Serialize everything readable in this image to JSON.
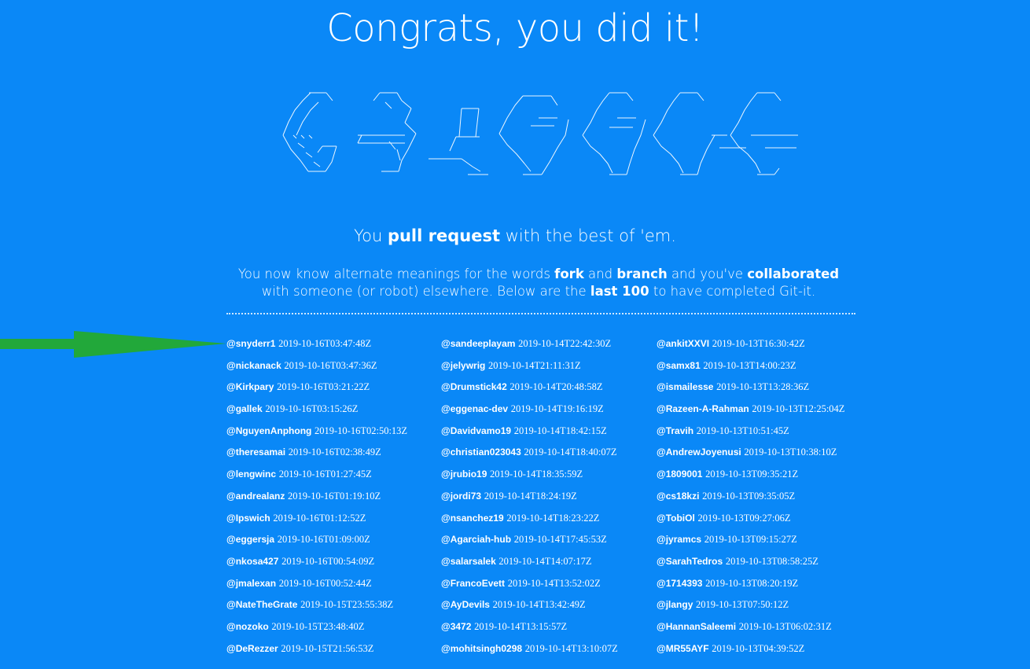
{
  "title": "Congrats, you did it!",
  "tagline": {
    "pre": "You ",
    "bold": "pull request",
    "post": " with the best of 'em."
  },
  "description": {
    "p1": "You now know alternate meanings for the words ",
    "b1": "fork",
    "p2": " and ",
    "b2": "branch",
    "p3": " and you've ",
    "b3": "collaborated",
    "p4": " with someone (or robot) elsewhere. Below are the ",
    "b4": "last 100",
    "p5": " to have completed Git-it."
  },
  "arrow_color": "#22a83a",
  "background_color": "#0a88f7",
  "columns": [
    [
      {
        "user": "@snyderr1",
        "date": "2019-10-16T03:47:48Z"
      },
      {
        "user": "@nickanack",
        "date": "2019-10-16T03:47:36Z"
      },
      {
        "user": "@Kirkpary",
        "date": "2019-10-16T03:21:22Z"
      },
      {
        "user": "@gallek",
        "date": "2019-10-16T03:15:26Z"
      },
      {
        "user": "@NguyenAnphong",
        "date": "2019-10-16T02:50:13Z"
      },
      {
        "user": "@theresamai",
        "date": "2019-10-16T02:38:49Z"
      },
      {
        "user": "@lengwinc",
        "date": "2019-10-16T01:27:45Z"
      },
      {
        "user": "@andrealanz",
        "date": "2019-10-16T01:19:10Z"
      },
      {
        "user": "@Ipswich",
        "date": "2019-10-16T01:12:52Z"
      },
      {
        "user": "@eggersja",
        "date": "2019-10-16T01:09:00Z"
      },
      {
        "user": "@nkosa427",
        "date": "2019-10-16T00:54:09Z"
      },
      {
        "user": "@jmalexan",
        "date": "2019-10-16T00:52:44Z"
      },
      {
        "user": "@NateTheGrate",
        "date": "2019-10-15T23:55:38Z"
      },
      {
        "user": "@nozoko",
        "date": "2019-10-15T23:48:40Z"
      },
      {
        "user": "@DeRezzer",
        "date": "2019-10-15T21:56:53Z"
      }
    ],
    [
      {
        "user": "@sandeeplayam",
        "date": "2019-10-14T22:42:30Z"
      },
      {
        "user": "@jelywrig",
        "date": "2019-10-14T21:11:31Z"
      },
      {
        "user": "@Drumstick42",
        "date": "2019-10-14T20:48:58Z"
      },
      {
        "user": "@eggenac-dev",
        "date": "2019-10-14T19:16:19Z"
      },
      {
        "user": "@Davidvamo19",
        "date": "2019-10-14T18:42:15Z"
      },
      {
        "user": "@christian023043",
        "date": "2019-10-14T18:40:07Z"
      },
      {
        "user": "@jrubio19",
        "date": "2019-10-14T18:35:59Z"
      },
      {
        "user": "@jordi73",
        "date": "2019-10-14T18:24:19Z"
      },
      {
        "user": "@nsanchez19",
        "date": "2019-10-14T18:23:22Z"
      },
      {
        "user": "@Agarciah-hub",
        "date": "2019-10-14T17:45:53Z"
      },
      {
        "user": "@salarsalek",
        "date": "2019-10-14T14:07:17Z"
      },
      {
        "user": "@FrancoEvett",
        "date": "2019-10-14T13:52:02Z"
      },
      {
        "user": "@AyDevils",
        "date": "2019-10-14T13:42:49Z"
      },
      {
        "user": "@3472",
        "date": "2019-10-14T13:15:57Z"
      },
      {
        "user": "@mohitsingh0298",
        "date": "2019-10-14T13:10:07Z"
      }
    ],
    [
      {
        "user": "@ankitXXVI",
        "date": "2019-10-13T16:30:42Z"
      },
      {
        "user": "@samx81",
        "date": "2019-10-13T14:00:23Z"
      },
      {
        "user": "@ismailesse",
        "date": "2019-10-13T13:28:36Z"
      },
      {
        "user": "@Razeen-A-Rahman",
        "date": "2019-10-13T12:25:04Z"
      },
      {
        "user": "@Travih",
        "date": "2019-10-13T10:51:45Z"
      },
      {
        "user": "@AndrewJoyenusi",
        "date": "2019-10-13T10:38:10Z"
      },
      {
        "user": "@1809001",
        "date": "2019-10-13T09:35:21Z"
      },
      {
        "user": "@cs18kzi",
        "date": "2019-10-13T09:35:05Z"
      },
      {
        "user": "@TobiOl",
        "date": "2019-10-13T09:27:06Z"
      },
      {
        "user": "@jyramcs",
        "date": "2019-10-13T09:15:27Z"
      },
      {
        "user": "@SarahTedros",
        "date": "2019-10-13T08:58:25Z"
      },
      {
        "user": "@1714393",
        "date": "2019-10-13T08:20:19Z"
      },
      {
        "user": "@jlangy",
        "date": "2019-10-13T07:50:12Z"
      },
      {
        "user": "@HannanSaleemi",
        "date": "2019-10-13T06:02:31Z"
      },
      {
        "user": "@MR55AYF",
        "date": "2019-10-13T04:39:52Z"
      }
    ]
  ]
}
